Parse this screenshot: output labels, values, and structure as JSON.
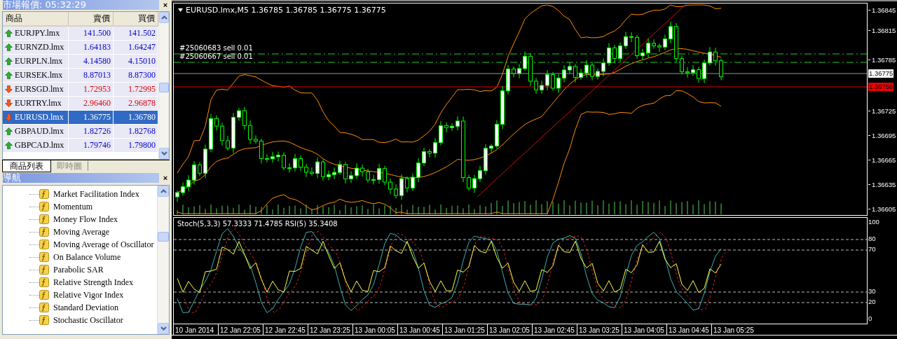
{
  "market_watch": {
    "title": "市場報價: 05:32:29",
    "close": "×",
    "columns": [
      "商品",
      "賣價",
      "買價"
    ],
    "rows": [
      {
        "symbol": "EURJPY.lmx",
        "bid": "141.500",
        "ask": "141.502",
        "kind": "up",
        "selected": false
      },
      {
        "symbol": "EURNZD.lmx",
        "bid": "1.64183",
        "ask": "1.64247",
        "kind": "up",
        "selected": false
      },
      {
        "symbol": "EURPLN.lmx",
        "bid": "4.14580",
        "ask": "4.15010",
        "kind": "up",
        "selected": false
      },
      {
        "symbol": "EURSEK.lmx",
        "bid": "8.87013",
        "ask": "8.87300",
        "kind": "up",
        "selected": false
      },
      {
        "symbol": "EURSGD.lmx",
        "bid": "1.72953",
        "ask": "1.72995",
        "kind": "down",
        "selected": false
      },
      {
        "symbol": "EURTRY.lmx",
        "bid": "2.96460",
        "ask": "2.96878",
        "kind": "down",
        "selected": false
      },
      {
        "symbol": "EURUSD.lmx",
        "bid": "1.36775",
        "ask": "1.36780",
        "kind": "down",
        "selected": true
      },
      {
        "symbol": "GBPAUD.lmx",
        "bid": "1.82726",
        "ask": "1.82768",
        "kind": "up",
        "selected": false
      },
      {
        "symbol": "GBPCAD.lmx",
        "bid": "1.79746",
        "ask": "1.79800",
        "kind": "up",
        "selected": false
      }
    ],
    "tabs": [
      {
        "label": "商品列表",
        "selected": true
      },
      {
        "label": "即時圖",
        "selected": false
      }
    ]
  },
  "navigator": {
    "title": "導航",
    "close": "×",
    "items": [
      "Market Facilitation Index",
      "Momentum",
      "Money Flow Index",
      "Moving Average",
      "Moving Average of Oscillator",
      "On Balance Volume",
      "Parabolic SAR",
      "Relative Strength Index",
      "Relative Vigor Index",
      "Standard Deviation",
      "Stochastic Oscillator"
    ]
  },
  "chart": {
    "header": "EURUSD.lmx,M5  1.36785 1.36785 1.36775 1.36775",
    "orders": [
      "#25060683 sell 0.01",
      "#25060667 sell 0.01"
    ],
    "price_labels": [
      "1.36845",
      "1.36815",
      "1.36785",
      "1.36725",
      "1.36695",
      "1.36665",
      "1.36635",
      "1.36605"
    ],
    "bid_price": "1.36775",
    "alert_price": "1.36758"
  },
  "indicator": {
    "header": "Stoch(5,3,3) 57.3333 71.4785  RSI(5) 35.3408",
    "levels": [
      "100",
      "80",
      "70",
      "30",
      "20",
      "0"
    ]
  },
  "time_labels": [
    "10 Jan 2014",
    "12 Jan 22:05",
    "12 Jan 22:45",
    "12 Jan 23:25",
    "13 Jan 00:05",
    "13 Jan 00:45",
    "13 Jan 01:25",
    "13 Jan 02:05",
    "13 Jan 02:45",
    "13 Jan 03:25",
    "13 Jan 04:05",
    "13 Jan 04:45",
    "13 Jan 05:25"
  ]
}
